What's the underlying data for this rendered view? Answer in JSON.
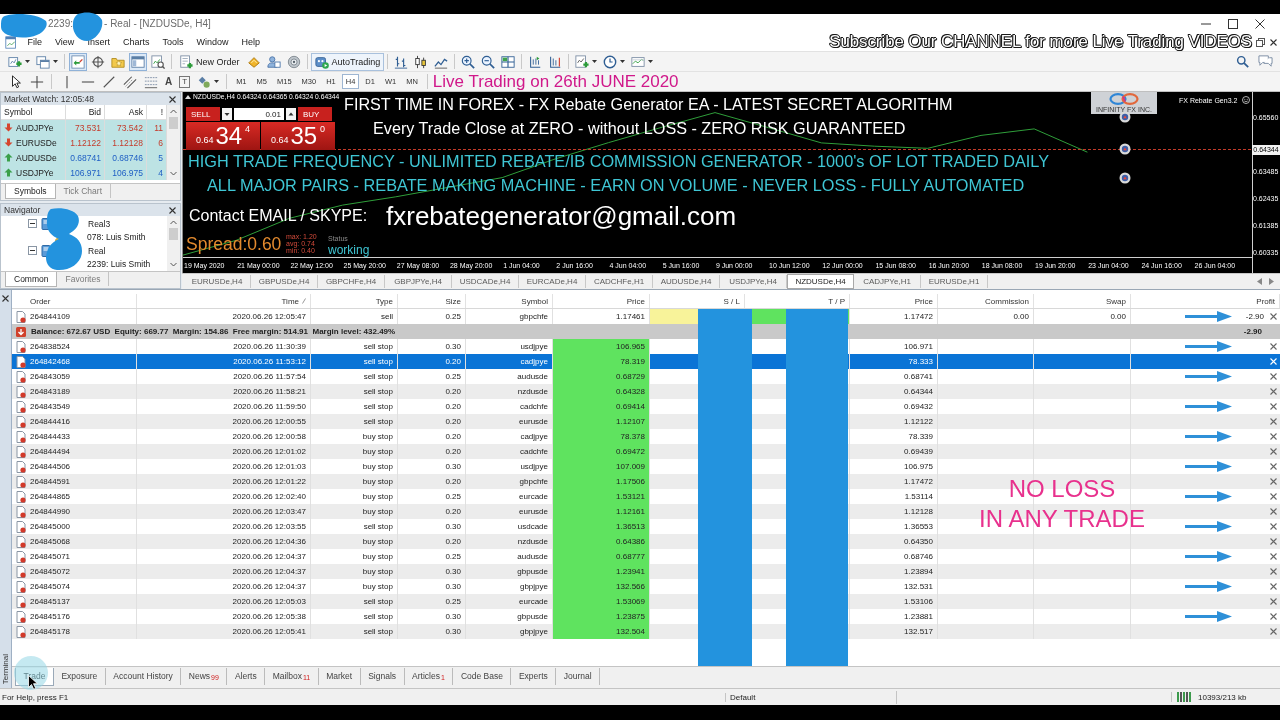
{
  "title_bar": {
    "title_start": "2239:",
    "title_end": "- Real - [NZDUSDe, H4]"
  },
  "menu": [
    "File",
    "View",
    "Insert",
    "Charts",
    "Tools",
    "Window",
    "Help"
  ],
  "banner": "Subscribe Our CHANNEL for more Live Trading VIDEOS",
  "toolbar": {
    "new_order": "New Order",
    "auto_trading": {
      "label": "AutoTrading",
      "on": true
    },
    "market_watch_on": true,
    "terminal_on": true
  },
  "drawing_tools": {
    "text_tool": "A",
    "label_tool": "T"
  },
  "timeframes": [
    {
      "label": "M1",
      "selected": false
    },
    {
      "label": "M5",
      "selected": false
    },
    {
      "label": "M15",
      "selected": false
    },
    {
      "label": "M30",
      "selected": false
    },
    {
      "label": "H1",
      "selected": false
    },
    {
      "label": "H4",
      "selected": true
    },
    {
      "label": "D1",
      "selected": false
    },
    {
      "label": "W1",
      "selected": false
    },
    {
      "label": "MN",
      "selected": false
    }
  ],
  "caption": "Live Trading on 26th JUNE 2020",
  "market_watch": {
    "title": "Market Watch: 12:05:48",
    "columns": [
      "Symbol",
      "Bid",
      "Ask",
      "!"
    ],
    "rows": [
      {
        "symbol": "AUDJPYe",
        "bid": "73.531",
        "ask": "73.542",
        "spread": "11",
        "up": false
      },
      {
        "symbol": "EURUSDe",
        "bid": "1.12122",
        "ask": "1.12128",
        "spread": "6",
        "up": false
      },
      {
        "symbol": "AUDUSDe",
        "bid": "0.68741",
        "ask": "0.68746",
        "spread": "5",
        "up": true
      },
      {
        "symbol": "USDJPYe",
        "bid": "106.971",
        "ask": "106.975",
        "spread": "4",
        "up": true
      }
    ],
    "tabs": [
      {
        "label": "Symbols",
        "selected": true
      },
      {
        "label": "Tick Chart",
        "selected": false
      }
    ]
  },
  "navigator": {
    "title": "Navigator",
    "tree": [
      {
        "label": "Real3",
        "expanded": true,
        "children": [
          {
            "label": "078: Luis Smith"
          }
        ]
      },
      {
        "label": "Real",
        "expanded": true,
        "children": [
          {
            "label": "2239: Luis Smith"
          }
        ]
      }
    ],
    "tabs": [
      {
        "label": "Common",
        "selected": true
      },
      {
        "label": "Favorites",
        "selected": false
      }
    ]
  },
  "chart": {
    "symbol": "NZDUSDe,H4",
    "ohlc": "0.64324 0.64365 0.64324 0.64344",
    "trade_panel": {
      "sell_label": "SELL",
      "buy_label": "BUY",
      "lot": "0.01",
      "sell_price": {
        "base": "0.64",
        "pips": "34",
        "point": "4"
      },
      "buy_price": {
        "base": "0.64",
        "pips": "35",
        "point": "0"
      }
    },
    "logo_caption": "INFINITY FX INC.",
    "ea_name": "FX Rebate Gen3.2",
    "headline": [
      "FIRST TIME IN FOREX - FX Rebate Generator EA - LATEST SECRET ALGORITHM",
      "Every Trade Close at ZERO - without LOSS - ZERO RISK GUARANTEED"
    ],
    "highlights": [
      "HIGH TRADE FREQUENCY - UNLIMITED REBATE/IB COMMISSION GENERATOR - 1000's OF LOT TRADED DAILY",
      "ALL MAJOR PAIRS - REBATE MAKING MACHINE - EARN ON VOLUME - NEVER LOSS - FULLY AUTOMATED"
    ],
    "contact_label": "Contact EMAIL / SKYPE:",
    "contact_email": "fxrebategenerator@gmail.com",
    "spread": "Spread:0.60",
    "spread_stats": [
      "max: 1.20",
      "avg: 0.74",
      "min: 0.40"
    ],
    "status_label": "Status",
    "status_value": "working",
    "chart_data": {
      "type": "line",
      "categories": [
        "19 May 2020",
        "21 May 00:00",
        "22 May 12:00",
        "25 May 20:00",
        "27 May 08:00",
        "28 May 20:00",
        "1 Jun 04:00",
        "2 Jun 16:00",
        "4 Jun 04:00",
        "5 Jun 16:00",
        "9 Jun 00:00",
        "10 Jun 12:00",
        "12 Jun 00:00",
        "15 Jun 08:00",
        "16 Jun 20:00",
        "18 Jun 08:00",
        "19 Jun 20:00",
        "23 Jun 04:00",
        "24 Jun 16:00",
        "26 Jun 04:00"
      ],
      "series": [
        {
          "color": "#2f9e3a",
          "values": [
            0.6027,
            0.6084,
            0.6169,
            0.622,
            0.6252,
            0.6289,
            0.6326,
            0.6398,
            0.6461,
            0.652,
            0.6577,
            0.6519,
            0.646,
            0.6447,
            0.6439,
            0.6489,
            0.6514,
            0.6424,
            null,
            null
          ]
        }
      ],
      "ylim": [
        0.60195,
        0.66564
      ],
      "yticks": [
        {
          "value": 0.6556,
          "label": "0.65560"
        },
        {
          "value": 0.63485,
          "label": "0.63485"
        },
        {
          "value": 0.62435,
          "label": "0.62435"
        },
        {
          "value": 0.61385,
          "label": "0.61385"
        },
        {
          "value": 0.60335,
          "label": "0.60335"
        }
      ],
      "ref_lines": [
        {
          "axis": "y",
          "value": 0.64344,
          "label": "0.64344",
          "color": "#c23b2b"
        }
      ]
    }
  },
  "chart_tabs": [
    {
      "label": "EURUSDe,H4",
      "selected": false
    },
    {
      "label": "GBPUSDe,H4",
      "selected": false
    },
    {
      "label": "GBPCHFe,H4",
      "selected": false
    },
    {
      "label": "GBPJPYe,H4",
      "selected": false
    },
    {
      "label": "USDCADe,H4",
      "selected": false
    },
    {
      "label": "EURCADe,H4",
      "selected": false
    },
    {
      "label": "CADCHFe,H1",
      "selected": false
    },
    {
      "label": "AUDUSDe,H4",
      "selected": false
    },
    {
      "label": "USDJPYe,H4",
      "selected": false
    },
    {
      "label": "NZDUSDe,H4",
      "selected": true
    },
    {
      "label": "CADJPYe,H1",
      "selected": false
    },
    {
      "label": "EURUSDe,H1",
      "selected": false
    }
  ],
  "terminal": {
    "title": "Terminal",
    "columns": [
      "Order",
      "Time",
      "Type",
      "Size",
      "Symbol",
      "Price",
      "S / L",
      "T / P",
      "Price",
      "Commission",
      "Swap",
      "Profit"
    ],
    "rows": [
      {
        "kind": "position",
        "order": "264844109",
        "time": "2020.06.26 12:05:47",
        "type": "sell",
        "size": "0.25",
        "symbol": "gbpchfe",
        "price": "1.17461",
        "current_price": "1.17472",
        "commission": "0.00",
        "swap": "0.00",
        "profit": "-2.90",
        "selected": false,
        "marked": true
      },
      {
        "kind": "balance",
        "text": "Balance: 672.67 USD  Equity: 669.77  Margin: 154.86  Free margin: 514.91  Margin level: 432.49%",
        "profit": "-2.90",
        "selected": false,
        "marked": false
      },
      {
        "kind": "pending",
        "order": "264838524",
        "time": "2020.06.26 11:30:39",
        "type": "sell stop",
        "size": "0.30",
        "symbol": "usdjpye",
        "price": "106.965",
        "current_price": "106.971",
        "selected": false,
        "marked": true
      },
      {
        "kind": "pending",
        "order": "264842468",
        "time": "2020.06.26 11:53:12",
        "type": "sell stop",
        "size": "0.20",
        "symbol": "cadjpye",
        "price": "78.319",
        "current_price": "78.333",
        "selected": true,
        "marked": false
      },
      {
        "kind": "pending",
        "order": "264843059",
        "time": "2020.06.26 11:57:54",
        "type": "sell stop",
        "size": "0.25",
        "symbol": "audusde",
        "price": "0.68729",
        "current_price": "0.68741",
        "selected": false,
        "marked": true
      },
      {
        "kind": "pending",
        "order": "264843189",
        "time": "2020.06.26 11:58:21",
        "type": "sell stop",
        "size": "0.20",
        "symbol": "nzdusde",
        "price": "0.64328",
        "current_price": "0.64344",
        "selected": false,
        "marked": false
      },
      {
        "kind": "pending",
        "order": "264843549",
        "time": "2020.06.26 11:59:50",
        "type": "sell stop",
        "size": "0.20",
        "symbol": "cadchfe",
        "price": "0.69414",
        "current_price": "0.69432",
        "selected": false,
        "marked": true
      },
      {
        "kind": "pending",
        "order": "264844416",
        "time": "2020.06.26 12:00:55",
        "type": "sell stop",
        "size": "0.20",
        "symbol": "eurusde",
        "price": "1.12107",
        "current_price": "1.12122",
        "selected": false,
        "marked": false
      },
      {
        "kind": "pending",
        "order": "264844433",
        "time": "2020.06.26 12:00:58",
        "type": "buy stop",
        "size": "0.20",
        "symbol": "cadjpye",
        "price": "78.378",
        "current_price": "78.339",
        "selected": false,
        "marked": true
      },
      {
        "kind": "pending",
        "order": "264844494",
        "time": "2020.06.26 12:01:02",
        "type": "buy stop",
        "size": "0.20",
        "symbol": "cadchfe",
        "price": "0.69472",
        "current_price": "0.69439",
        "selected": false,
        "marked": false
      },
      {
        "kind": "pending",
        "order": "264844506",
        "time": "2020.06.26 12:01:03",
        "type": "buy stop",
        "size": "0.30",
        "symbol": "usdjpye",
        "price": "107.009",
        "current_price": "106.975",
        "selected": false,
        "marked": true
      },
      {
        "kind": "pending",
        "order": "264844591",
        "time": "2020.06.26 12:01:22",
        "type": "buy stop",
        "size": "0.20",
        "symbol": "gbpchfe",
        "price": "1.17506",
        "current_price": "1.17472",
        "selected": false,
        "marked": false
      },
      {
        "kind": "pending",
        "order": "264844865",
        "time": "2020.06.26 12:02:40",
        "type": "buy stop",
        "size": "0.25",
        "symbol": "eurcade",
        "price": "1.53121",
        "current_price": "1.53114",
        "selected": false,
        "marked": true
      },
      {
        "kind": "pending",
        "order": "264844990",
        "time": "2020.06.26 12:03:47",
        "type": "buy stop",
        "size": "0.20",
        "symbol": "eurusde",
        "price": "1.12161",
        "current_price": "1.12128",
        "selected": false,
        "marked": false
      },
      {
        "kind": "pending",
        "order": "264845000",
        "time": "2020.06.26 12:03:55",
        "type": "sell stop",
        "size": "0.30",
        "symbol": "usdcade",
        "price": "1.36513",
        "current_price": "1.36553",
        "selected": false,
        "marked": true
      },
      {
        "kind": "pending",
        "order": "264845068",
        "time": "2020.06.26 12:04:36",
        "type": "buy stop",
        "size": "0.20",
        "symbol": "nzdusde",
        "price": "0.64386",
        "current_price": "0.64350",
        "selected": false,
        "marked": false
      },
      {
        "kind": "pending",
        "order": "264845071",
        "time": "2020.06.26 12:04:37",
        "type": "buy stop",
        "size": "0.25",
        "symbol": "audusde",
        "price": "0.68777",
        "current_price": "0.68746",
        "selected": false,
        "marked": true
      },
      {
        "kind": "pending",
        "order": "264845072",
        "time": "2020.06.26 12:04:37",
        "type": "buy stop",
        "size": "0.30",
        "symbol": "gbpusde",
        "price": "1.23941",
        "current_price": "1.23894",
        "selected": false,
        "marked": false
      },
      {
        "kind": "pending",
        "order": "264845074",
        "time": "2020.06.26 12:04:37",
        "type": "buy stop",
        "size": "0.30",
        "symbol": "gbpjpye",
        "price": "132.566",
        "current_price": "132.531",
        "selected": false,
        "marked": true
      },
      {
        "kind": "pending",
        "order": "264845137",
        "time": "2020.06.26 12:05:03",
        "type": "sell stop",
        "size": "0.25",
        "symbol": "eurcade",
        "price": "1.53069",
        "current_price": "1.53106",
        "selected": false,
        "marked": false
      },
      {
        "kind": "pending",
        "order": "264845176",
        "time": "2020.06.26 12:05:38",
        "type": "sell stop",
        "size": "0.30",
        "symbol": "gbpusde",
        "price": "1.23875",
        "current_price": "1.23881",
        "selected": false,
        "marked": true
      },
      {
        "kind": "pending",
        "order": "264845178",
        "time": "2020.06.26 12:05:41",
        "type": "sell stop",
        "size": "0.30",
        "symbol": "gbpjpye",
        "price": "132.504",
        "current_price": "132.517",
        "selected": false,
        "marked": false
      }
    ],
    "annotation": [
      "NO LOSS",
      "IN ANY TRADE"
    ],
    "tabs": [
      {
        "label": "Trade",
        "selected": true
      },
      {
        "label": "Exposure",
        "selected": false
      },
      {
        "label": "Account History",
        "selected": false
      },
      {
        "label": "News",
        "badge": "99",
        "selected": false
      },
      {
        "label": "Alerts",
        "selected": false
      },
      {
        "label": "Mailbox",
        "badge": "11",
        "selected": false
      },
      {
        "label": "Market",
        "selected": false
      },
      {
        "label": "Signals",
        "selected": false
      },
      {
        "label": "Articles",
        "badge": "1",
        "selected": false
      },
      {
        "label": "Code Base",
        "selected": false
      },
      {
        "label": "Experts",
        "selected": false
      },
      {
        "label": "Journal",
        "selected": false
      }
    ]
  },
  "status_bar": {
    "help": "For Help, press F1",
    "profile": "Default",
    "traffic": "10393/213 kb"
  }
}
